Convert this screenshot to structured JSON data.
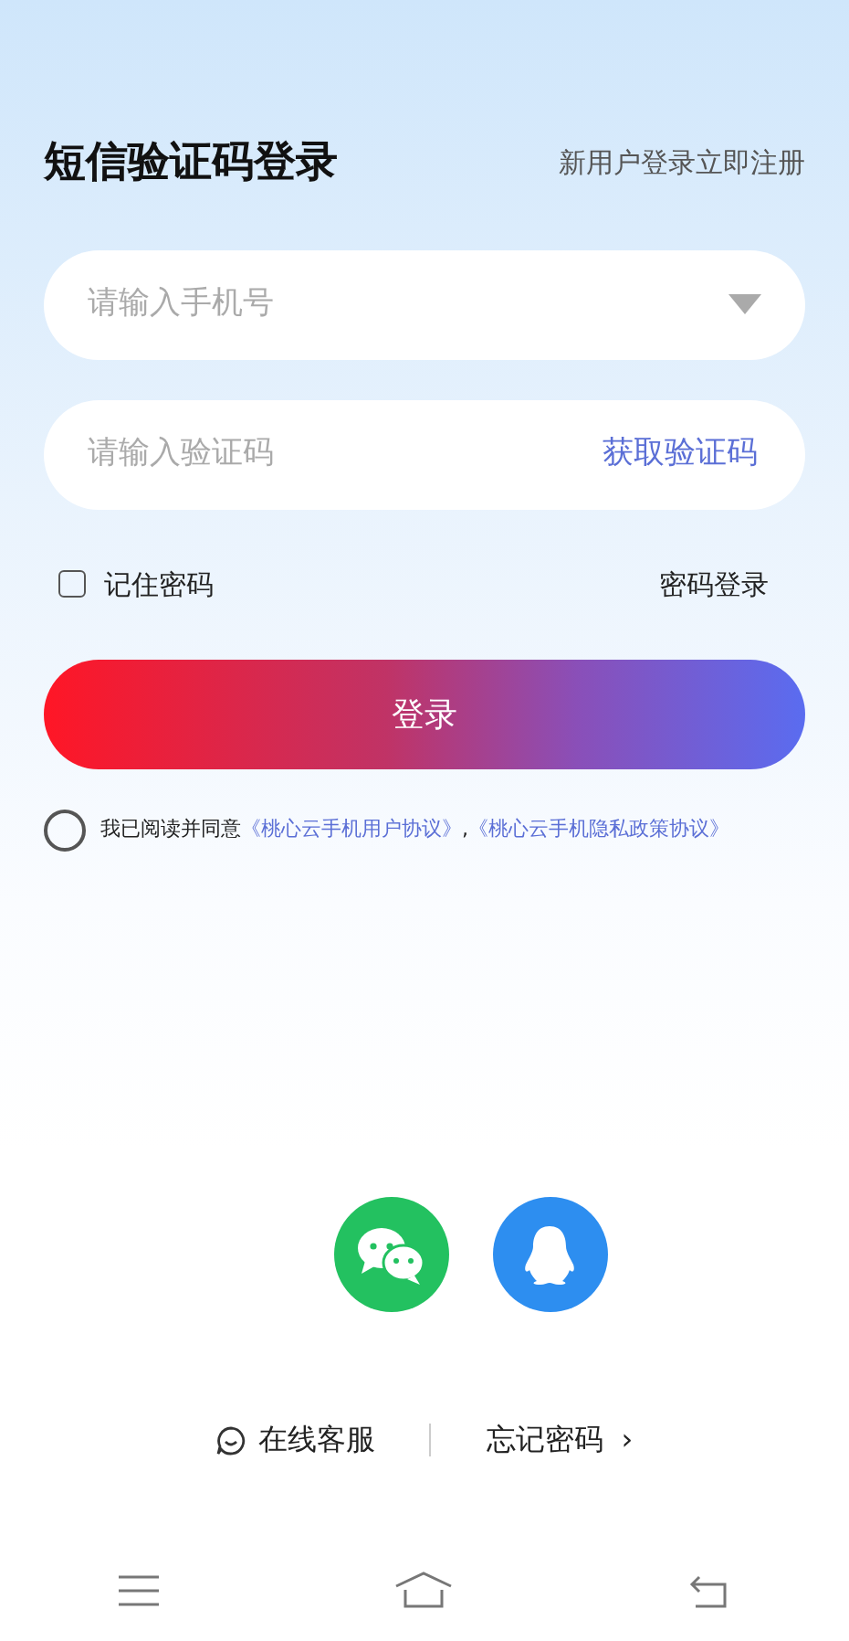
{
  "header": {
    "title": "短信验证码登录",
    "register_link": "新用户登录立即注册"
  },
  "phone_field": {
    "placeholder": "请输入手机号"
  },
  "code_field": {
    "placeholder": "请输入验证码",
    "get_code_button": "获取验证码"
  },
  "remember": {
    "label": "记住密码",
    "checked": false
  },
  "password_login_link": "密码登录",
  "login_button": "登录",
  "agreement": {
    "checked": false,
    "text": "我已阅读并同意",
    "links": [
      "《桃心云手机用户协议》",
      "《桃心云手机隐私政策协议》"
    ],
    "separator": ","
  },
  "social_logins": [
    {
      "kind": "wechat"
    },
    {
      "kind": "qq"
    }
  ],
  "footer": {
    "service": "在线客服",
    "forgot": "忘记密码",
    "forgot_arrow": "›"
  }
}
